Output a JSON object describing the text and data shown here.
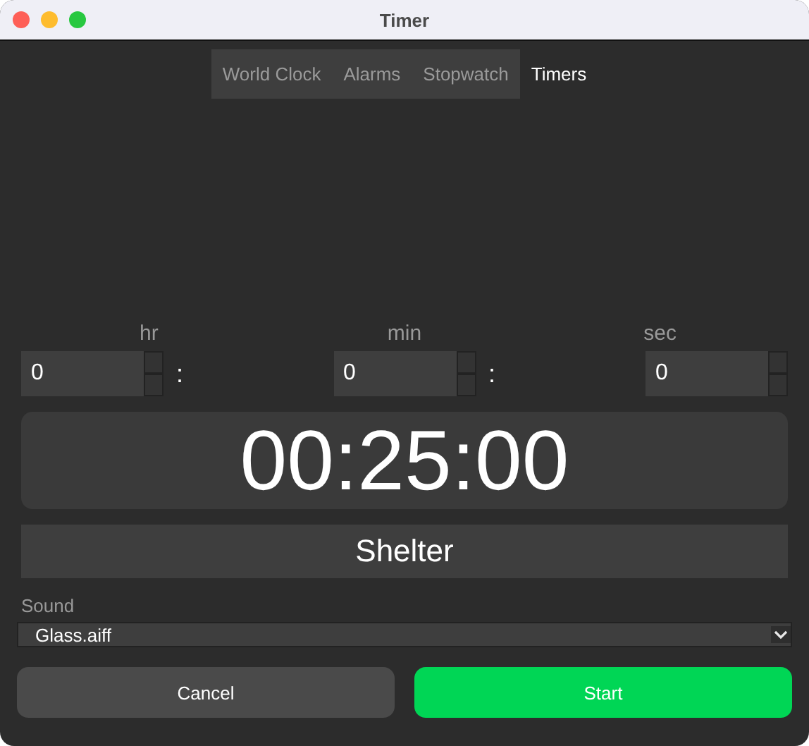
{
  "window": {
    "title": "Timer"
  },
  "tabs": [
    {
      "label": "World Clock",
      "selected": false
    },
    {
      "label": "Alarms",
      "selected": false
    },
    {
      "label": "Stopwatch",
      "selected": false
    },
    {
      "label": "Timers",
      "selected": true
    }
  ],
  "units": [
    {
      "label": "hr",
      "value": "0"
    },
    {
      "label": "min",
      "value": "0"
    },
    {
      "label": "sec",
      "value": "0"
    }
  ],
  "separator": ":",
  "display": "00:25:00",
  "timer_name": "Shelter",
  "sound": {
    "label": "Sound",
    "value": "Glass.aiff"
  },
  "buttons": [
    {
      "label": "Cancel",
      "kind": "secondary"
    },
    {
      "label": "Start",
      "kind": "primary"
    }
  ]
}
